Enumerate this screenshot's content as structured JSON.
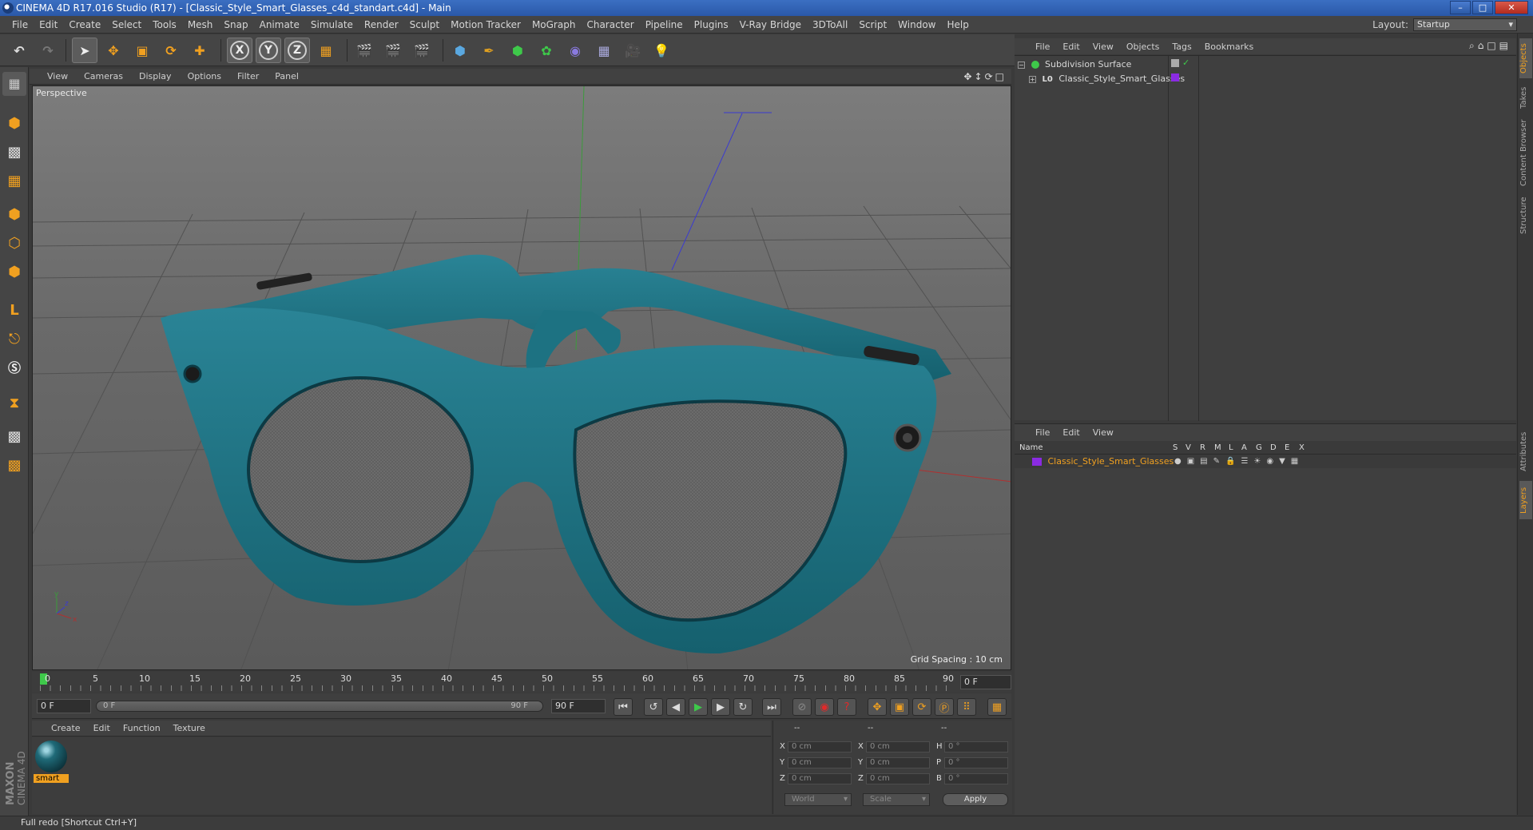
{
  "window": {
    "title": "CINEMA 4D R17.016 Studio (R17) - [Classic_Style_Smart_Glasses_c4d_standart.c4d] - Main",
    "min": "–",
    "max": "□",
    "close": "✕"
  },
  "menu": [
    "File",
    "Edit",
    "Create",
    "Select",
    "Tools",
    "Mesh",
    "Snap",
    "Animate",
    "Simulate",
    "Render",
    "Sculpt",
    "Motion Tracker",
    "MoGraph",
    "Character",
    "Pipeline",
    "Plugins",
    "V-Ray Bridge",
    "3DToAll",
    "Script",
    "Window",
    "Help"
  ],
  "layout": {
    "label": "Layout:",
    "value": "Startup"
  },
  "toolbar": {
    "x": "X",
    "y": "Y",
    "z": "Z"
  },
  "viewport": {
    "menu": [
      "View",
      "Cameras",
      "Display",
      "Options",
      "Filter",
      "Panel"
    ],
    "label": "Perspective",
    "grid_spacing": "Grid Spacing : 10 cm",
    "frame_color": "#1f6f7f"
  },
  "timeline": {
    "ticks": [
      "0",
      "5",
      "10",
      "15",
      "20",
      "25",
      "30",
      "35",
      "40",
      "45",
      "50",
      "55",
      "60",
      "65",
      "70",
      "75",
      "80",
      "85",
      "90"
    ],
    "current_frame": "0 F",
    "start": "0 F",
    "range_start": "0 F",
    "range_end": "90 F",
    "end": "90 F"
  },
  "material_manager": {
    "menu": [
      "Create",
      "Edit",
      "Function",
      "Texture"
    ],
    "material_name": "smart"
  },
  "coordinates": {
    "headers": [
      "--",
      "--",
      "--"
    ],
    "rows": [
      {
        "a": "X",
        "av": "0 cm",
        "b": "X",
        "bv": "0 cm",
        "c": "H",
        "cv": "0 °"
      },
      {
        "a": "Y",
        "av": "0 cm",
        "b": "Y",
        "bv": "0 cm",
        "c": "P",
        "cv": "0 °"
      },
      {
        "a": "Z",
        "av": "0 cm",
        "b": "Z",
        "bv": "0 cm",
        "c": "B",
        "cv": "0 °"
      }
    ],
    "mode": "World",
    "transform": "Scale",
    "apply": "Apply"
  },
  "status": "Full redo [Shortcut Ctrl+Y]",
  "objects": {
    "menu": [
      "File",
      "Edit",
      "View",
      "Objects",
      "Tags",
      "Bookmarks"
    ],
    "items": [
      {
        "name": "Subdivision Surface"
      },
      {
        "name": "Classic_Style_Smart_Glasses"
      }
    ]
  },
  "layers": {
    "menu": [
      "File",
      "Edit",
      "View"
    ],
    "columns": [
      "Name",
      "S",
      "V",
      "R",
      "M",
      "L",
      "A",
      "G",
      "D",
      "E",
      "X"
    ],
    "items": [
      {
        "name": "Classic_Style_Smart_Glasses",
        "color": "#8a2be2"
      }
    ]
  },
  "side_tabs": [
    "Objects",
    "Takes",
    "Content Browser",
    "Structure",
    "Attributes",
    "Layers"
  ],
  "brand": {
    "maxon": "MAXON",
    "c4d": "CINEMA 4D"
  }
}
